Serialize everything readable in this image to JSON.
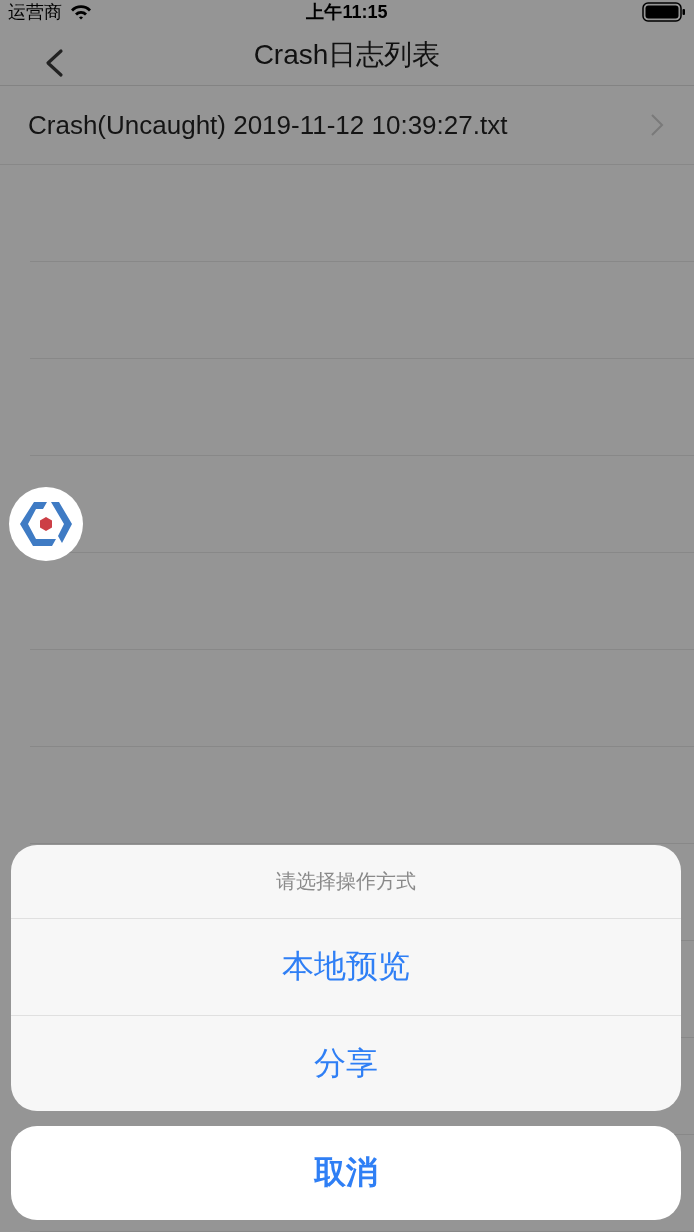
{
  "status_bar": {
    "carrier": "运营商",
    "time": "上午11:15"
  },
  "nav_bar": {
    "title": "Crash日志列表"
  },
  "rows": [
    {
      "title": "Crash(Uncaught) 2019-11-12 10:39:27.txt"
    }
  ],
  "action_sheet": {
    "title": "请选择操作方式",
    "actions": [
      "本地预览",
      "分享"
    ],
    "cancel": "取消"
  }
}
